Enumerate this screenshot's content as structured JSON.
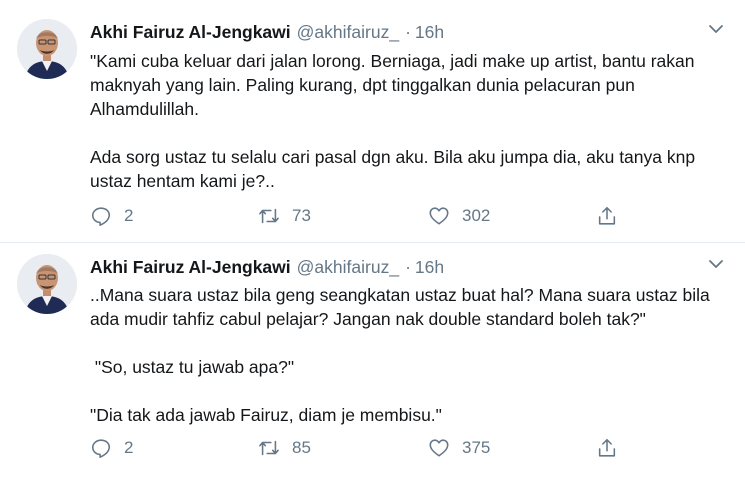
{
  "tweets": [
    {
      "author": "Akhi Fairuz Al-Jengkawi",
      "handle": "@akhifairuz_",
      "separator": "·",
      "time": "16h",
      "paragraphs": [
        "\"Kami cuba keluar dari jalan lorong. Berniaga, jadi make up artist, bantu rakan maknyah yang lain. Paling kurang, dpt tinggalkan dunia pelacuran pun Alhamdulillah.",
        "Ada sorg ustaz tu selalu cari pasal dgn aku. Bila aku jumpa dia, aku tanya knp ustaz hentam kami je?.."
      ],
      "replies": "2",
      "retweets": "73",
      "likes": "302"
    },
    {
      "author": "Akhi Fairuz Al-Jengkawi",
      "handle": "@akhifairuz_",
      "separator": "·",
      "time": "16h",
      "paragraphs": [
        "..Mana suara ustaz bila geng seangkatan ustaz buat hal? Mana suara ustaz bila ada mudir tahfiz cabul pelajar? Jangan nak double standard boleh tak?\"",
        " \"So, ustaz tu jawab apa?\"",
        "\"Dia tak ada jawab Fairuz, diam je membisu.\""
      ],
      "replies": "2",
      "retweets": "85",
      "likes": "375"
    }
  ],
  "icons": {
    "reply": "reply-icon",
    "retweet": "retweet-icon",
    "like": "heart-icon",
    "share": "share-icon",
    "caret": "chevron-down-icon"
  },
  "colors": {
    "text": "#14171a",
    "muted": "#657786",
    "divider": "#e6ecf0",
    "jacket": "#1f2b55"
  }
}
